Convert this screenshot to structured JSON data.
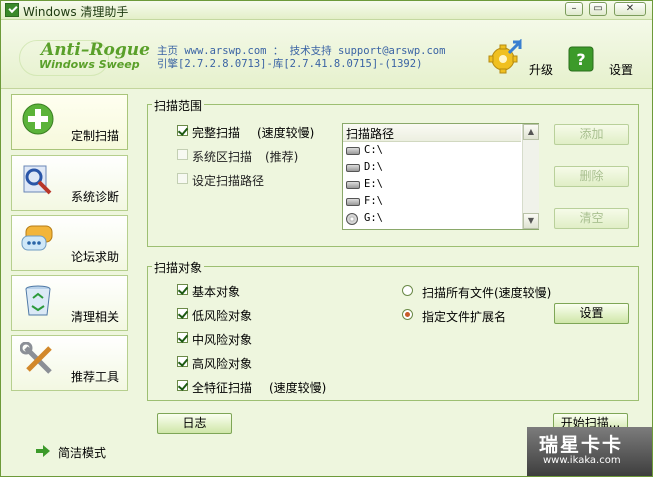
{
  "window": {
    "title": "Windows 清理助手"
  },
  "header": {
    "logo_line1": "Anti–Rogue",
    "logo_line2": "Windows Sweep",
    "info_line1": "主页 www.arswp.com ： 技术支持 support@arswp.com",
    "info_line2": "引擎[2.7.2.8.0713]-库[2.7.41.8.0715]-(1392)",
    "upgrade_label": "升级",
    "settings_label": "设置"
  },
  "sidebar": {
    "items": [
      {
        "label": "定制扫描",
        "icon": "plus-icon"
      },
      {
        "label": "系统诊断",
        "icon": "diagnosis-icon"
      },
      {
        "label": "论坛求助",
        "icon": "chat-bubble-icon"
      },
      {
        "label": "清理相关",
        "icon": "recycle-bin-icon"
      },
      {
        "label": "推荐工具",
        "icon": "tools-icon"
      }
    ],
    "simple_mode": "简洁模式"
  },
  "scan_scope": {
    "title": "扫描范围",
    "options": [
      {
        "label": "完整扫描",
        "note": "(速度较慢)",
        "checked": true,
        "enabled": true
      },
      {
        "label": "系统区扫描",
        "note": "(推荐)",
        "checked": false,
        "enabled": false
      },
      {
        "label": "设定扫描路径",
        "note": "",
        "checked": false,
        "enabled": false
      }
    ],
    "path_header": "扫描路径",
    "paths": [
      "C:\\",
      "D:\\",
      "E:\\",
      "F:\\",
      "G:\\"
    ],
    "buttons": {
      "add": "添加",
      "delete": "删除",
      "clear": "清空"
    }
  },
  "scan_objects": {
    "title": "扫描对象",
    "checks": [
      {
        "label": "基本对象",
        "note": "",
        "checked": true
      },
      {
        "label": "低风险对象",
        "note": "",
        "checked": true
      },
      {
        "label": "中风险对象",
        "note": "",
        "checked": true
      },
      {
        "label": "高风险对象",
        "note": "",
        "checked": true
      },
      {
        "label": "全特征扫描",
        "note": "(速度较慢)",
        "checked": true
      }
    ],
    "radios": [
      {
        "label": "扫描所有文件(速度较慢)",
        "selected": false
      },
      {
        "label": "指定文件扩展名",
        "selected": true
      }
    ],
    "settings_button": "设置"
  },
  "footer": {
    "log_button": "日志",
    "start_button": "开始扫描..."
  },
  "watermark": {
    "line1": "瑞星卡卡",
    "line2": "www.ikaka.com"
  },
  "colors": {
    "accent": "#5aa02a",
    "panel_bg": "#eef6de",
    "border": "#9dbf72",
    "link": "#3a63a4"
  }
}
